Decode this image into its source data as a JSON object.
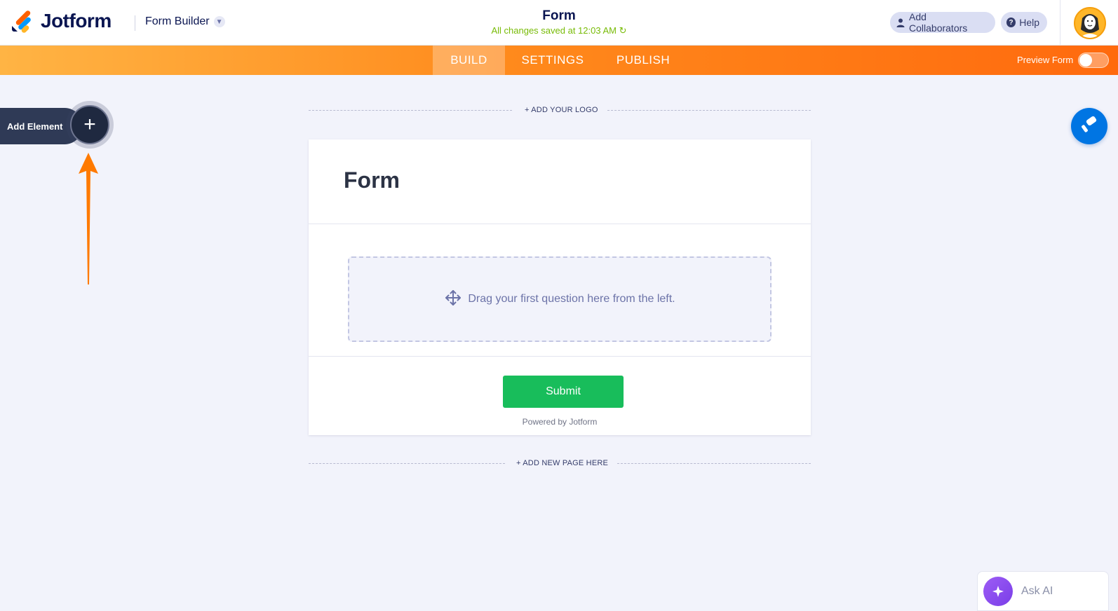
{
  "header": {
    "logo_text": "Jotform",
    "builder_label": "Form Builder",
    "form_title": "Form",
    "save_status": "All changes saved at 12:03 AM",
    "collaborators_label": "Add Collaborators",
    "help_label": "Help"
  },
  "nav": {
    "tabs": [
      {
        "label": "BUILD",
        "active": true
      },
      {
        "label": "SETTINGS",
        "active": false
      },
      {
        "label": "PUBLISH",
        "active": false
      }
    ],
    "preview_label": "Preview Form",
    "preview_enabled": false
  },
  "sidebar": {
    "add_element_label": "Add Element"
  },
  "canvas": {
    "add_logo_label": "+ ADD YOUR LOGO",
    "form_heading": "Form",
    "drop_zone_text": "Drag your first question here from the left.",
    "submit_label": "Submit",
    "powered_by": "Powered by Jotform",
    "add_page_label": "+ ADD NEW PAGE HERE"
  },
  "assistant": {
    "ask_ai_label": "Ask AI"
  },
  "colors": {
    "brand_orange": "#ff6100",
    "submit_green": "#18bd5b",
    "save_green": "#78bb07",
    "designer_blue": "#0075e3",
    "ai_purple": "#9d5cf5"
  }
}
